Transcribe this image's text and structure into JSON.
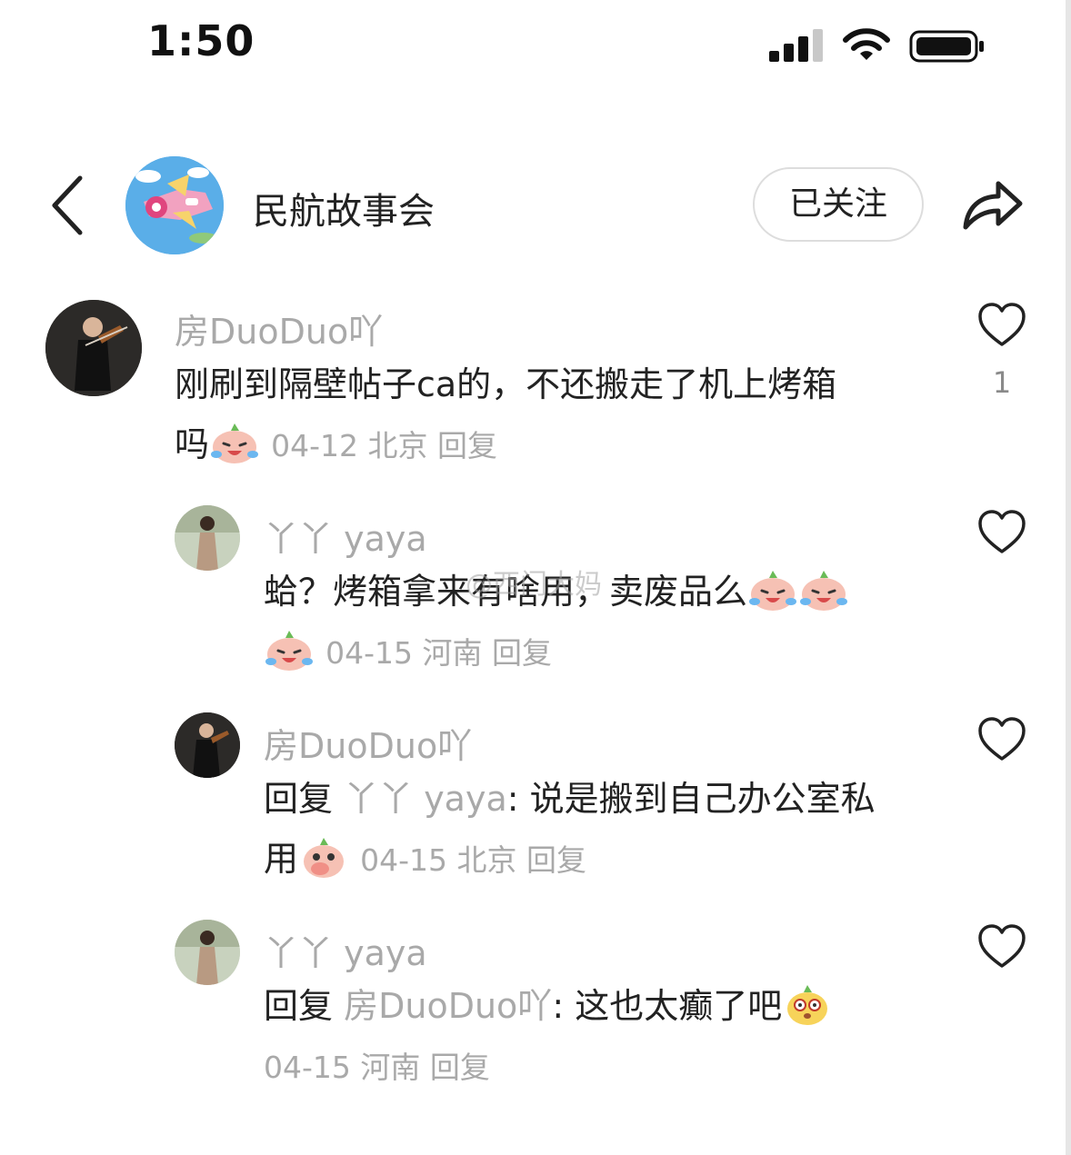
{
  "status_bar": {
    "time": "1:50"
  },
  "header": {
    "channel_name": "民航故事会",
    "follow_label": "已关注"
  },
  "icons": {
    "back": "chevron-left-icon",
    "share": "share-arrow-icon",
    "like": "heart-outline-icon"
  },
  "comments": [
    {
      "user": "房DuoDuo吖",
      "text_line1": "刚刷到隔壁帖子ca的，不还搬走了机上烤箱",
      "text_line2": "吗",
      "emoji": [
        "crying-laughing-face"
      ],
      "date": "04-12",
      "location": "北京",
      "reply_label": "回复",
      "likes": "1"
    },
    {
      "user": "丫丫 yaya",
      "text_line1": "蛤？烤箱拿来有啥用，卖废品么",
      "emoji": [
        "crying-laughing-face",
        "crying-laughing-face",
        "crying-laughing-face"
      ],
      "date": "04-15",
      "location": "河南",
      "reply_label": "回复"
    },
    {
      "user": "房DuoDuo吖",
      "reply_prefix": "回复",
      "reply_target": "丫丫 yaya",
      "text_line1": ": 说是搬到自己办公室私",
      "text_line2": "用",
      "emoji": [
        "covering-mouth-face"
      ],
      "date": "04-15",
      "location": "北京",
      "reply_label": "回复"
    },
    {
      "user": "丫丫 yaya",
      "reply_prefix": "回复",
      "reply_target": "房DuoDuo吖",
      "text_line1": ": 这也太癫了吧",
      "emoji": [
        "dizzy-face"
      ],
      "date": "04-15",
      "location": "河南",
      "reply_label": "回复"
    }
  ],
  "watermark": "@西门大妈"
}
